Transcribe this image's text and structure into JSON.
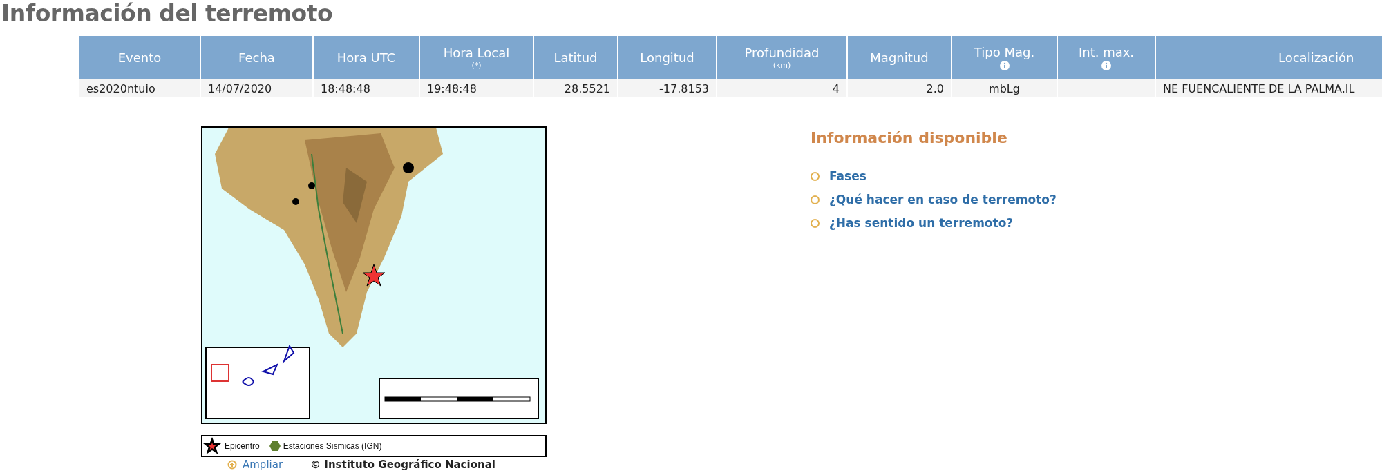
{
  "page_title": "Información del terremoto",
  "table": {
    "columns": [
      {
        "label": "Evento"
      },
      {
        "label": "Fecha"
      },
      {
        "label": "Hora UTC"
      },
      {
        "label": "Hora Local",
        "note": "(*)"
      },
      {
        "label": "Latitud"
      },
      {
        "label": "Longitud"
      },
      {
        "label": "Profundidad",
        "note": "(km)"
      },
      {
        "label": "Magnitud"
      },
      {
        "label": "Tipo Mag.",
        "info_icon": true
      },
      {
        "label": "Int. max.",
        "info_icon": true
      },
      {
        "label": "Localización"
      }
    ],
    "rows": [
      {
        "cells": [
          "es2020ntuio",
          "14/07/2020",
          "18:48:48",
          "19:48:48",
          "28.5521",
          "-17.8153",
          "4",
          "2.0",
          "mbLg",
          "",
          "NE FUENCALIENTE DE LA PALMA.IL"
        ]
      }
    ]
  },
  "map": {
    "kind": "picture",
    "legend": [
      {
        "kind": "epicenter",
        "label": "Epicentro"
      },
      {
        "kind": "station",
        "label": "Estaciones Sismicas (IGN)"
      }
    ],
    "enlarge_link": "Ampliar",
    "credit": "© Instituto Geográfico Nacional"
  },
  "info": {
    "heading": "Información disponible",
    "links": [
      "Fases",
      "¿Qué hacer en caso de terremoto?",
      "¿Has sentido un terremoto?"
    ]
  }
}
